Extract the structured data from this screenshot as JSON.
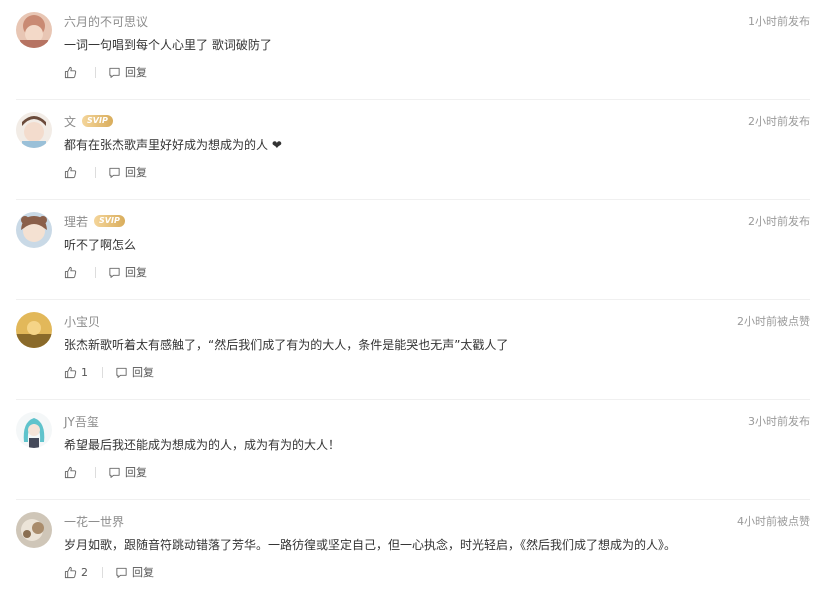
{
  "comments": [
    {
      "username": "六月的不可思议",
      "svip": false,
      "time": "1小时前发布",
      "text": "一词一句唱到每个人心里了 歌词破防了",
      "likes": "",
      "reply_label": "回复",
      "avatar_color": "#c98a73"
    },
    {
      "username": "文",
      "svip": true,
      "svip_label": "SVIP",
      "time": "2小时前发布",
      "text": "都有在张杰歌声里好好成为想成为的人 ❤",
      "likes": "",
      "reply_label": "回复",
      "avatar_color": "#e9d3c6"
    },
    {
      "username": "理若",
      "svip": true,
      "svip_label": "SVIP",
      "time": "2小时前发布",
      "text": "听不了啊怎么",
      "likes": "",
      "reply_label": "回复",
      "avatar_color": "#d8c3b5"
    },
    {
      "username": "小宝贝",
      "svip": false,
      "time": "2小时前被点赞",
      "text": "张杰新歌听着太有感触了，“然后我们成了有为的大人，条件是能哭也无声”太戳人了",
      "likes": "1",
      "reply_label": "回复",
      "avatar_color": "#c89a3a"
    },
    {
      "username": "JY吾玺",
      "svip": false,
      "time": "3小时前发布",
      "text": "希望最后我还能成为想成为的人，成为有为的大人！",
      "likes": "",
      "reply_label": "回复",
      "avatar_color": "#7fc6cf"
    },
    {
      "username": "一花一世界",
      "svip": false,
      "time": "4小时前被点赞",
      "text": "岁月如歌，跟随音符跳动错落了芳华。一路彷徨或坚定自己，但一心执念，时光轻启，《然后我们成了想成为的人》。",
      "likes": "2",
      "reply_label": "回复",
      "avatar_color": "#d9d0c4"
    }
  ]
}
